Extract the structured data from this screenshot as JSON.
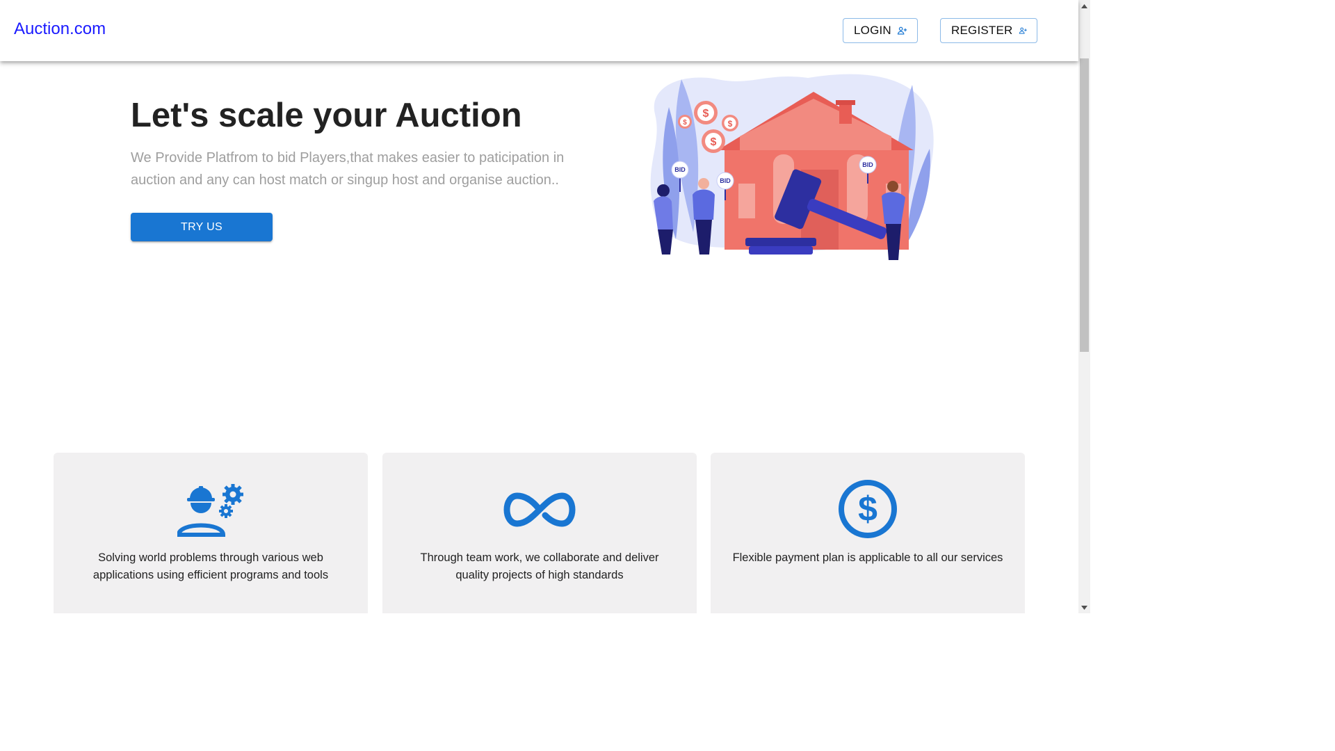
{
  "header": {
    "brand": "Auction.com",
    "login_label": "LOGIN",
    "register_label": "REGISTER"
  },
  "hero": {
    "title": "Let's scale your Auction",
    "description": "We Provide Platfrom to bid Players,that makes easier to paticipation in auction and any can host match or singup host and organise auction..",
    "cta_label": "TRY US",
    "illustration": {
      "bid_label": "BID",
      "coin_symbol": "$"
    }
  },
  "features": [
    {
      "icon": "engineer-gears-icon",
      "text": "Solving world problems through various web applications using efficient programs and tools"
    },
    {
      "icon": "infinity-icon",
      "text": "Through team work, we collaborate and deliver quality projects of high standards"
    },
    {
      "icon": "dollar-circle-icon",
      "text": "Flexible payment plan is applicable to all our services"
    }
  ],
  "colors": {
    "primary": "#1976d2",
    "brand_link": "#1a1aff",
    "card_bg": "#f1f0f1",
    "muted_text": "#9e9e9e",
    "house": "#f0746a"
  }
}
